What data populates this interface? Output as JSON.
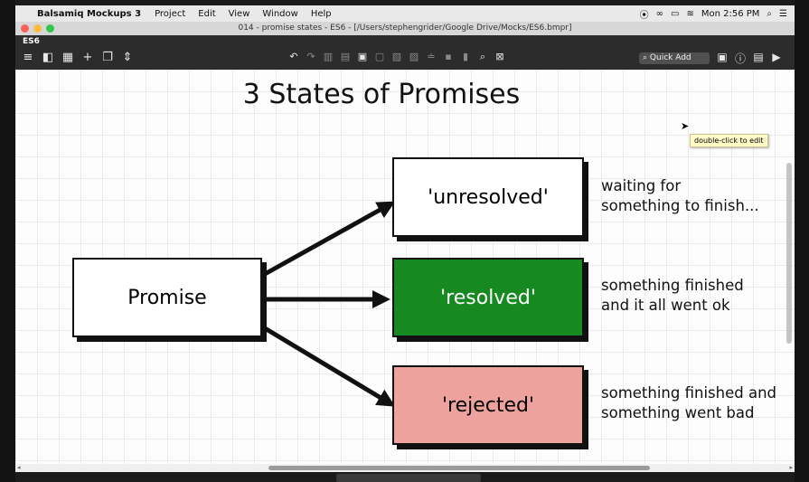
{
  "menubar": {
    "apple": "",
    "app_name": "Balsamiq Mockups 3",
    "items": [
      "Project",
      "Edit",
      "View",
      "Window",
      "Help"
    ],
    "clock": "Mon 2:56 PM"
  },
  "window": {
    "title": "014 - promise states - ES6 - [/Users/stephengrider/Google Drive/Mocks/ES6.bmpr]",
    "tab": "ES6"
  },
  "toolbar": {
    "quick_add": "Quick Add"
  },
  "mockup": {
    "title": "3 States of Promises",
    "promise_label": "Promise",
    "states": [
      {
        "label": "'unresolved'",
        "desc1": "waiting for",
        "desc2": "something to finish...",
        "color": "#ffffff"
      },
      {
        "label": "'resolved'",
        "desc1": "something finished",
        "desc2": "and it all went ok",
        "color": "#168a20"
      },
      {
        "label": "'rejected'",
        "desc1": "something finished and",
        "desc2": "something went bad",
        "color": "#eea29d"
      }
    ],
    "tooltip": "double-click to edit"
  }
}
